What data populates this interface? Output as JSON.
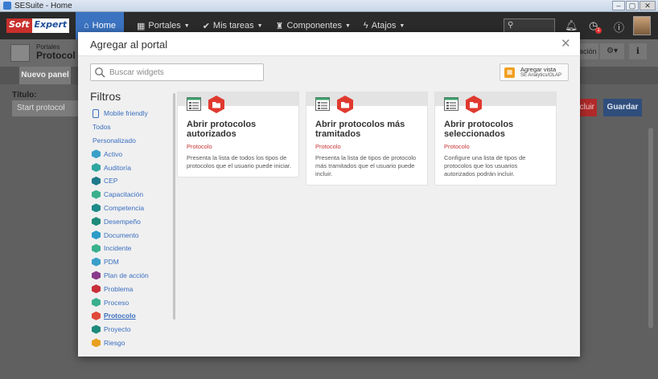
{
  "window": {
    "title": "SESuite - Home",
    "controls": [
      "–",
      "▢",
      "✕"
    ]
  },
  "header": {
    "logo_left": "Soft",
    "logo_right": "Expert",
    "nav": [
      {
        "label": "Home",
        "icon": "home-icon"
      },
      {
        "label": "Portales",
        "icon": "portal-icon"
      },
      {
        "label": "Mis tareas",
        "icon": "check-icon"
      },
      {
        "label": "Componentes",
        "icon": "trophy-icon"
      },
      {
        "label": "Atajos",
        "icon": "bolt-icon"
      }
    ],
    "notification_badge": "1"
  },
  "background_page": {
    "breadcrumb": "Portales",
    "title": "Protocol",
    "tab": "Nuevo panel",
    "title_label": "Título:",
    "title_value": "Start protocol",
    "excluir_label": "cluir",
    "guardar_label": "Guardar",
    "action_label": "ación"
  },
  "modal": {
    "title": "Agregar al portal",
    "close_glyph": "✕",
    "search_placeholder": "Buscar widgets",
    "add_view": {
      "line1": "Agregar vista",
      "line2": "SE Analytics/OLAP"
    },
    "filters_title": "Filtros",
    "filters": [
      {
        "label": "Mobile friendly",
        "icon": "mobile-icon",
        "color": "#3a6ec0"
      },
      {
        "label": "Todos",
        "icon": null
      },
      {
        "label": "Personalizado",
        "icon": null
      },
      {
        "label": "Activo",
        "icon": "activo-icon",
        "color": "#3aa0c8"
      },
      {
        "label": "Auditoría",
        "icon": "auditoria-icon",
        "color": "#2fa6a0"
      },
      {
        "label": "CEP",
        "icon": "cep-icon",
        "color": "#1e7a8a"
      },
      {
        "label": "Capacitación",
        "icon": "capacitacion-icon",
        "color": "#3cb08c"
      },
      {
        "label": "Competencia",
        "icon": "competencia-icon",
        "color": "#1d8a8a"
      },
      {
        "label": "Desempeño",
        "icon": "desempeno-icon",
        "color": "#1f8a7a"
      },
      {
        "label": "Documento",
        "icon": "documento-icon",
        "color": "#2d9bc8"
      },
      {
        "label": "Incidente",
        "icon": "incidente-icon",
        "color": "#3ab08c"
      },
      {
        "label": "PDM",
        "icon": "pdm-icon",
        "color": "#3a9ec8"
      },
      {
        "label": "Plan de acción",
        "icon": "plan-accion-icon",
        "color": "#8a3a8a"
      },
      {
        "label": "Problema",
        "icon": "problema-icon",
        "color": "#c8303a"
      },
      {
        "label": "Proceso",
        "icon": "proceso-icon",
        "color": "#3ab08c"
      },
      {
        "label": "Protocolo",
        "icon": "protocolo-icon",
        "color": "#e04a3a",
        "active": true
      },
      {
        "label": "Proyecto",
        "icon": "proyecto-icon",
        "color": "#1e8a7a"
      },
      {
        "label": "Riesgo",
        "icon": "riesgo-icon",
        "color": "#e8a020"
      }
    ],
    "widgets": [
      {
        "title": "Abrir protocolos autorizados",
        "category": "Protocolo",
        "description": "Presenta la lista de todos los tipos de protocolos que el usuario puede iniciar."
      },
      {
        "title": "Abrir protocolos más tramitados",
        "category": "Protocolo",
        "description": "Presenta la lista de tipos de protocolo más tramitados que el usuario puede incluir."
      },
      {
        "title": "Abrir protocolos seleccionados",
        "category": "Protocolo",
        "description": "Configure una lista de tipos de protocolos que los usuarios autorizados podrán incluir."
      }
    ]
  }
}
